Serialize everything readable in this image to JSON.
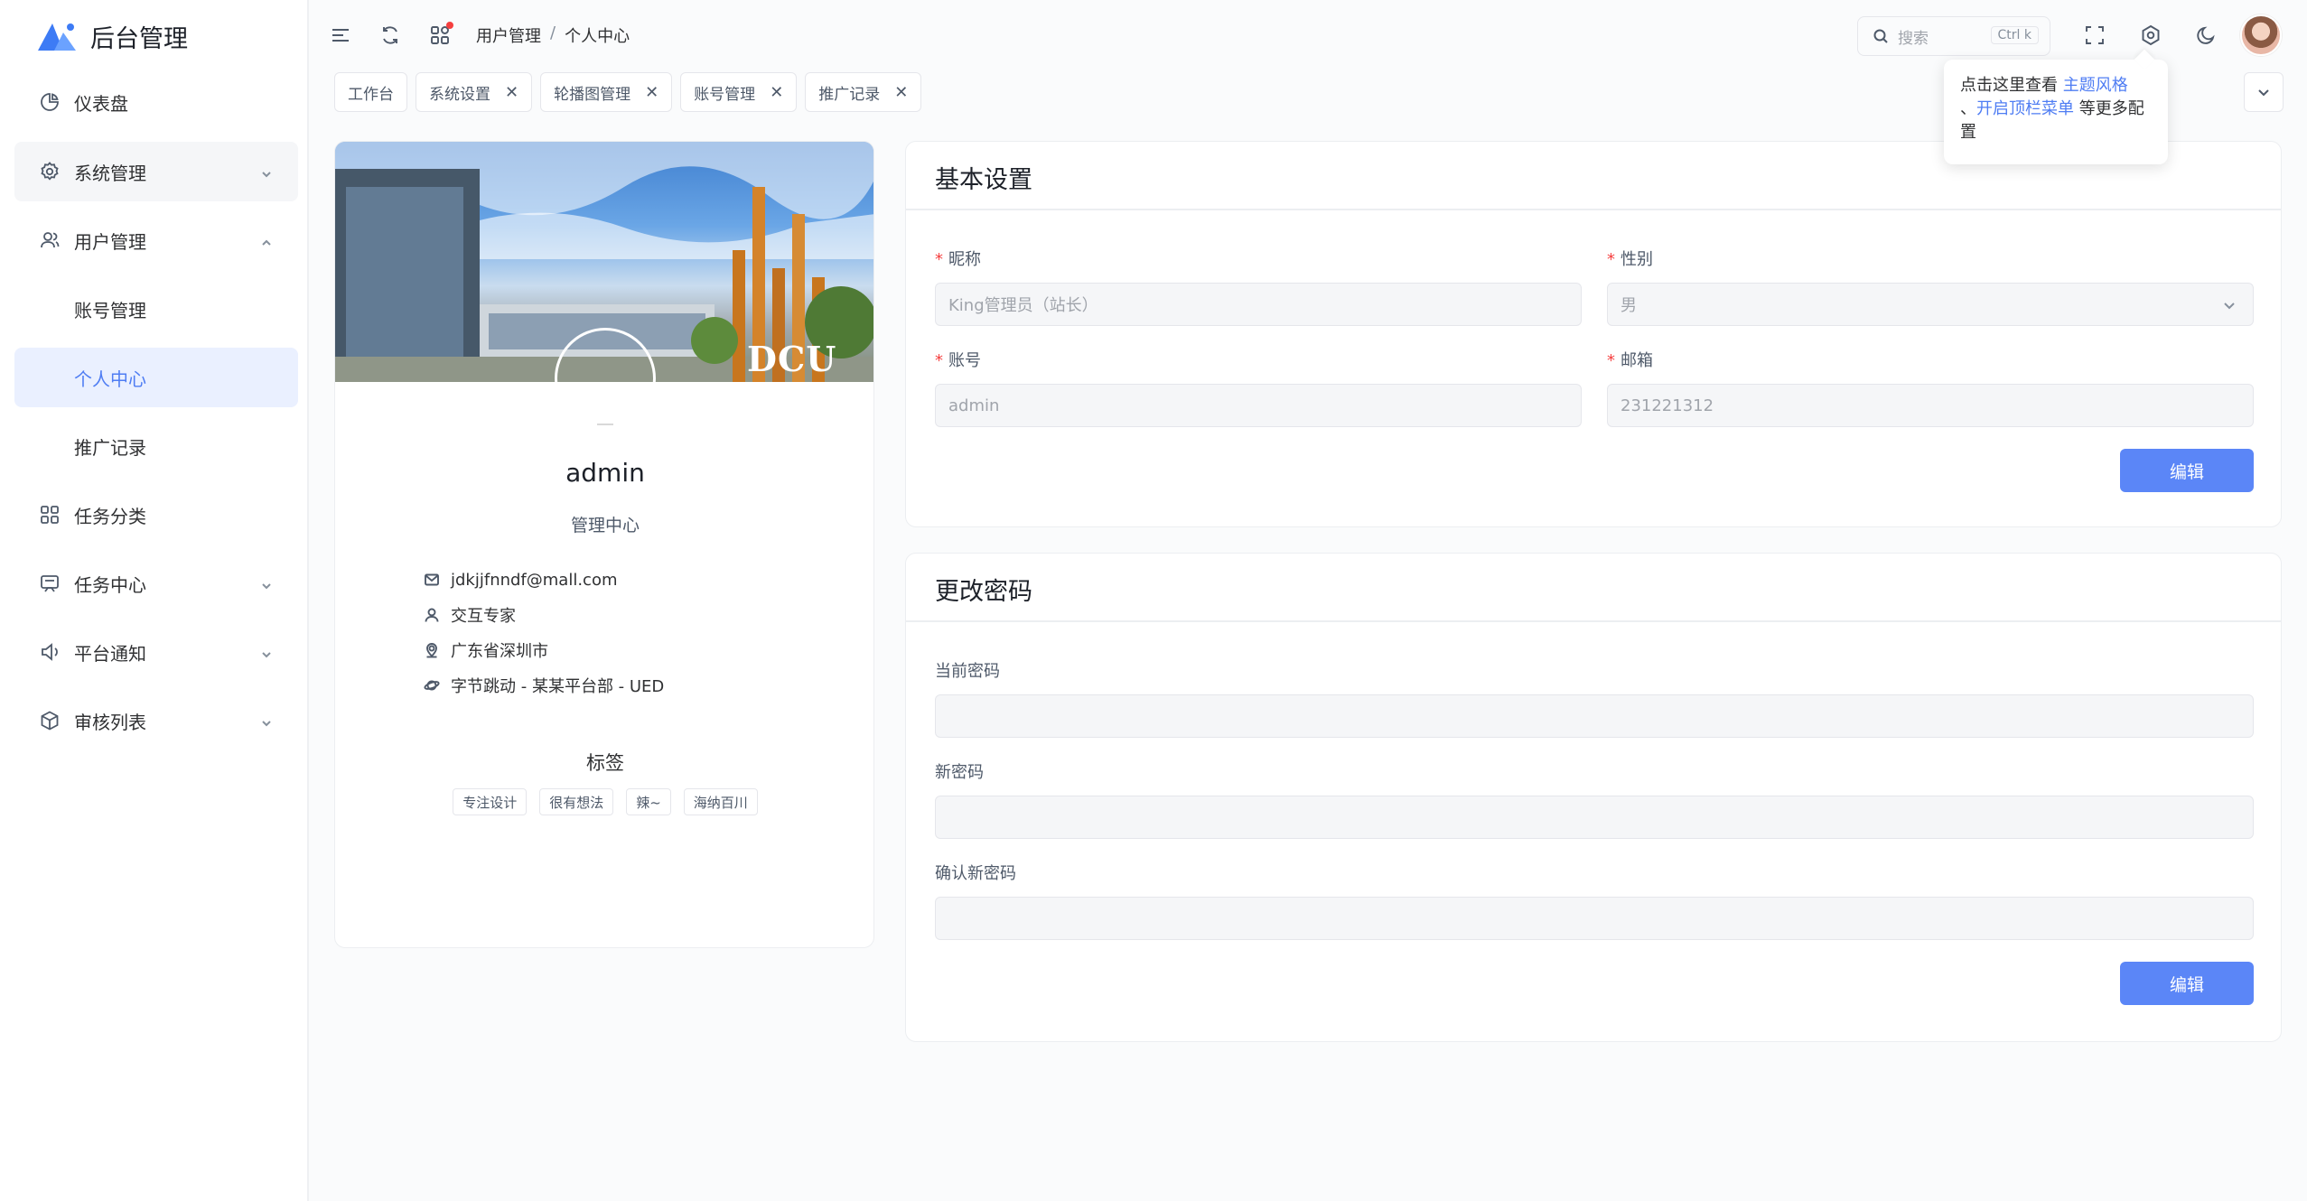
{
  "app": {
    "title": "后台管理"
  },
  "sidebar": {
    "items": [
      {
        "label": "仪表盘",
        "icon": "pie-chart-icon"
      },
      {
        "label": "系统管理",
        "icon": "gear-icon"
      },
      {
        "label": "用户管理",
        "icon": "users-icon"
      },
      {
        "label": "账号管理"
      },
      {
        "label": "个人中心"
      },
      {
        "label": "推广记录"
      },
      {
        "label": "任务分类",
        "icon": "grid-icon"
      },
      {
        "label": "任务中心",
        "icon": "task-icon"
      },
      {
        "label": "平台通知",
        "icon": "speaker-icon"
      },
      {
        "label": "审核列表",
        "icon": "box-icon"
      }
    ]
  },
  "header": {
    "breadcrumb": [
      "用户管理",
      "/",
      "个人中心"
    ],
    "search_placeholder": "搜索",
    "search_shortcut": "Ctrl k"
  },
  "tabs": [
    {
      "label": "工作台"
    },
    {
      "label": "系统设置"
    },
    {
      "label": "轮播图管理"
    },
    {
      "label": "账号管理"
    },
    {
      "label": "推广记录"
    }
  ],
  "tooltip": {
    "text1": "点击这里查看 ",
    "link1": "主题风格",
    "text2": "、",
    "link2": "开启顶栏菜单",
    "text3": " 等更多配置"
  },
  "profile": {
    "cover_text": "DCU",
    "username": "admin",
    "subtitle": "管理中心",
    "email": "jdkjjfnndf@mall.com",
    "title": "交互专家",
    "location": "广东省深圳市",
    "org": "字节跳动 - 某某平台部 - UED",
    "tags_title": "标签",
    "tags": [
      "专注设计",
      "很有想法",
      "辣~",
      "海纳百川"
    ]
  },
  "basic": {
    "title": "基本设置",
    "nickname_label": "昵称",
    "nickname_value": "King管理员（站长）",
    "gender_label": "性别",
    "gender_value": "男",
    "account_label": "账号",
    "account_value": "admin",
    "email_label": "邮箱",
    "email_value": "231221312",
    "edit_label": "编辑"
  },
  "password": {
    "title": "更改密码",
    "current_label": "当前密码",
    "new_label": "新密码",
    "confirm_label": "确认新密码",
    "edit_label": "编辑"
  },
  "colors": {
    "accent": "#5b86f7",
    "active_bg": "#eaf0ff",
    "required": "#f53f3f"
  }
}
